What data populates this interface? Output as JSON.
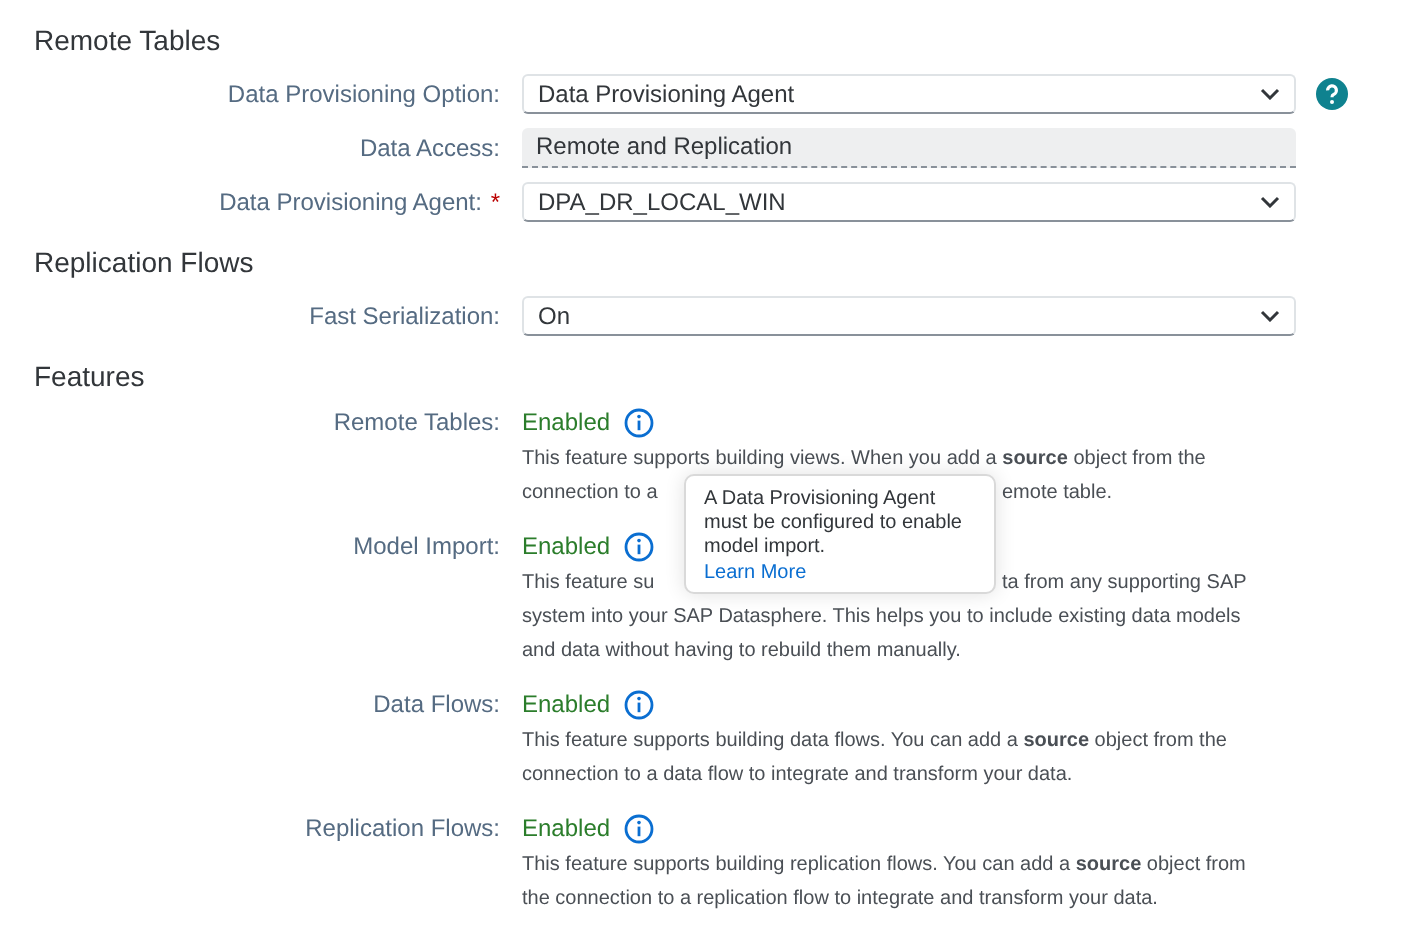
{
  "sections": [
    {
      "title": "Remote Tables",
      "fields": [
        {
          "label": "Data Provisioning Option:",
          "kind": "dropdown",
          "value": "Data Provisioning Agent",
          "help": true
        },
        {
          "label": "Data Access:",
          "kind": "readonly",
          "value": "Remote and Replication"
        },
        {
          "label": "Data Provisioning Agent:",
          "required_mark": "*",
          "kind": "dropdown",
          "value": "DPA_DR_LOCAL_WIN"
        }
      ]
    },
    {
      "title": "Replication Flows",
      "fields": [
        {
          "label": "Fast Serialization:",
          "kind": "dropdown",
          "value": "On"
        }
      ]
    }
  ],
  "features": {
    "title": "Features",
    "items": [
      {
        "label": "Remote Tables:",
        "status": "Enabled",
        "description": [
          [
            "This feature supports building views. When you add a **source** object from the"
          ],
          [
            "connection to a",
            "emote table."
          ]
        ]
      },
      {
        "label": "Model Import:",
        "status": "Enabled",
        "description": [
          [
            "This feature su",
            "ta from any supporting SAP"
          ],
          [
            "system into your SAP Datasphere. This helps you to include existing data models"
          ],
          [
            "and data without having to rebuild them manually."
          ]
        ]
      },
      {
        "label": "Data Flows:",
        "status": "Enabled",
        "description": [
          [
            "This feature supports building data flows. You can add a **source** object from the"
          ],
          [
            "connection to a data flow to integrate and transform your data."
          ]
        ]
      },
      {
        "label": "Replication Flows:",
        "status": "Enabled",
        "description": [
          [
            "This feature supports building replication flows. You can add a **source** object from"
          ],
          [
            "the connection to a replication flow to integrate and transform your data."
          ]
        ]
      }
    ]
  },
  "popover": {
    "text": "A Data Provisioning Agent must be configured to enable model import.",
    "link": "Learn More"
  }
}
